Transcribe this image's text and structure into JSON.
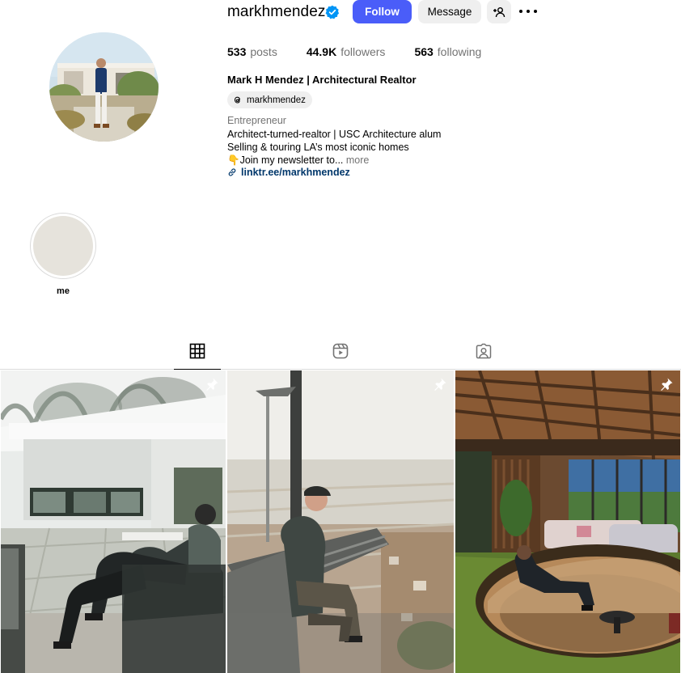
{
  "profile": {
    "username": "markhmendez",
    "verified": true,
    "follow_label": "Follow",
    "message_label": "Message",
    "posts_count": "533",
    "posts_label": "posts",
    "followers_count": "44.9K",
    "followers_label": "followers",
    "following_count": "563",
    "following_label": "following",
    "full_name": "Mark H Mendez | Architectural Realtor",
    "threads_handle": "markhmendez",
    "category": "Entrepreneur",
    "bio_line_1": "Architect-turned-realtor | USC Architecture alum",
    "bio_line_2": "Selling & touring LA’s most iconic homes",
    "bio_line_3": "👇Join my newsletter to...",
    "bio_more": "more",
    "link_text": "linktr.ee/markhmendez"
  },
  "highlights": [
    {
      "label": "me"
    }
  ],
  "tabs": [
    {
      "icon": "grid-icon",
      "active": true
    },
    {
      "icon": "reels-icon",
      "active": false
    },
    {
      "icon": "tagged-icon",
      "active": false
    }
  ],
  "posts": [
    {
      "pinned": true,
      "subject": "man seated in modernist white house"
    },
    {
      "pinned": true,
      "subject": "man sitting on bench above city view"
    },
    {
      "pinned": true,
      "subject": "man lounging in sunken conversation pit"
    }
  ],
  "colors": {
    "follow_button": "#4a5df9",
    "secondary_button": "#efefef",
    "verified_badge": "#0095f6",
    "link": "#00376b",
    "muted_text": "#737373"
  }
}
